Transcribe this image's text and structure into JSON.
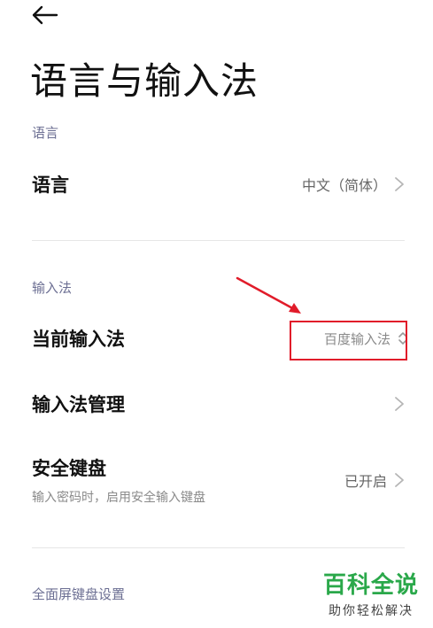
{
  "page": {
    "title": "语言与输入法"
  },
  "sections": {
    "language": {
      "label": "语言",
      "row": {
        "title": "语言",
        "value": "中文（简体）"
      }
    },
    "input_method": {
      "label": "输入法",
      "current": {
        "title": "当前输入法",
        "value": "百度输入法"
      },
      "manage": {
        "title": "输入法管理"
      },
      "secure": {
        "title": "安全键盘",
        "subtitle": "输入密码时，启用安全输入键盘",
        "value": "已开启"
      }
    },
    "fullscreen": {
      "label": "全面屏键盘设置"
    }
  },
  "annotation": {
    "color": "#e11c2a"
  },
  "watermark": {
    "main": "百科全说",
    "sub": "助你轻松解决",
    "color": "#2aa84a"
  },
  "icons": [
    "back-arrow-icon",
    "chevron-right-icon",
    "chevron-up-down-icon"
  ]
}
